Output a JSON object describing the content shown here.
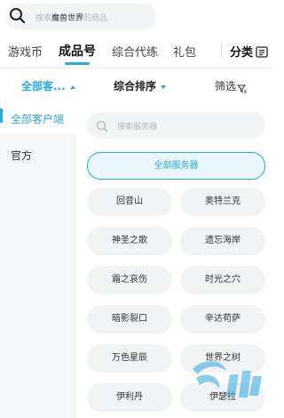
{
  "top_search": {
    "prefix": "搜索",
    "keyword": "魔兽世界",
    "suffix": "的商品"
  },
  "tabs": [
    {
      "label": "游戏币"
    },
    {
      "label": "成品号"
    },
    {
      "label": "综合代练"
    },
    {
      "label": "礼包"
    }
  ],
  "category_label": "分类",
  "filters": {
    "client": "全部客...",
    "sort": "综合排序",
    "screen": "筛选"
  },
  "sidebar": [
    {
      "label": "全部客户端"
    },
    {
      "label": "官方"
    }
  ],
  "server_search": {
    "placeholder": "搜索服务器"
  },
  "all_servers_label": "全部服务器",
  "servers": [
    {
      "label": "回音山"
    },
    {
      "label": "奥特兰克"
    },
    {
      "label": "神圣之歌"
    },
    {
      "label": "遗忘海岸"
    },
    {
      "label": "霜之哀伤"
    },
    {
      "label": "时光之穴"
    },
    {
      "label": "暗影裂口"
    },
    {
      "label": "辛达苟萨"
    },
    {
      "label": "万色星辰"
    },
    {
      "label": "世界之树"
    },
    {
      "label": "伊利丹"
    },
    {
      "label": "伊瑟拉"
    }
  ],
  "colors": {
    "accent": "#2aa8e0",
    "sidebar_bg": "#f4f5f7",
    "chip_bg": "#f2f3f5"
  }
}
